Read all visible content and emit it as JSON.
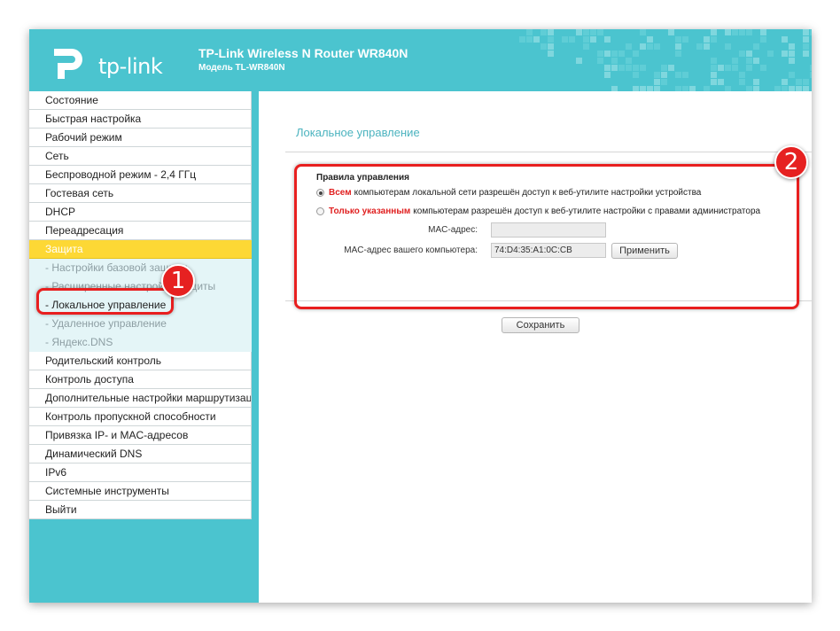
{
  "header": {
    "logo_text": "tp-link",
    "title": "TP-Link Wireless N Router WR840N",
    "subtitle": "Модель TL-WR840N"
  },
  "sidebar": {
    "items": [
      {
        "label": "Состояние",
        "kind": "top"
      },
      {
        "label": "Быстрая настройка",
        "kind": "top"
      },
      {
        "label": "Рабочий режим",
        "kind": "top"
      },
      {
        "label": "Сеть",
        "kind": "top"
      },
      {
        "label": "Беспроводной режим - 2,4 ГГц",
        "kind": "top"
      },
      {
        "label": "Гостевая сеть",
        "kind": "top"
      },
      {
        "label": "DHCP",
        "kind": "top"
      },
      {
        "label": "Переадресация",
        "kind": "top"
      },
      {
        "label": "Защита",
        "kind": "active"
      },
      {
        "label": "- Настройки базовой защиты",
        "kind": "sub"
      },
      {
        "label": "- Расширенные настройки защиты",
        "kind": "sub"
      },
      {
        "label": "- Локальное управление",
        "kind": "sub-current"
      },
      {
        "label": "- Удаленное управление",
        "kind": "sub"
      },
      {
        "label": "- Яндекс.DNS",
        "kind": "sub"
      },
      {
        "label": "Родительский контроль",
        "kind": "top"
      },
      {
        "label": "Контроль доступа",
        "kind": "top"
      },
      {
        "label": "Дополнительные настройки маршрутизации",
        "kind": "top"
      },
      {
        "label": "Контроль пропускной способности",
        "kind": "top"
      },
      {
        "label": "Привязка IP- и MAC-адресов",
        "kind": "top"
      },
      {
        "label": "Динамический DNS",
        "kind": "top"
      },
      {
        "label": "IPv6",
        "kind": "top"
      },
      {
        "label": "Системные инструменты",
        "kind": "top"
      },
      {
        "label": "Выйти",
        "kind": "top"
      }
    ]
  },
  "main": {
    "section_title": "Локальное управление",
    "rules_title": "Правила управления",
    "option_all": {
      "highlight": "Всем",
      "text": "компьютерам локальной сети разрешён доступ к веб-утилите настройки устройства",
      "selected": true
    },
    "option_listed": {
      "highlight": "Только указанным",
      "text": "компьютерам разрешён доступ к веб-утилите настройки с правами администратора",
      "selected": false
    },
    "mac_label": "MAC-адрес:",
    "mac_value": "",
    "your_mac_label": "MAC-адрес вашего компьютера:",
    "your_mac_value": "74:D4:35:A1:0C:CB",
    "apply_button": "Применить",
    "save_button": "Сохранить"
  },
  "annotations": {
    "marker_1": "1",
    "marker_2": "2"
  },
  "colors": {
    "brand_teal": "#4bc4cf",
    "active_yellow": "#fdd835",
    "callout_red": "#e81f1f"
  }
}
